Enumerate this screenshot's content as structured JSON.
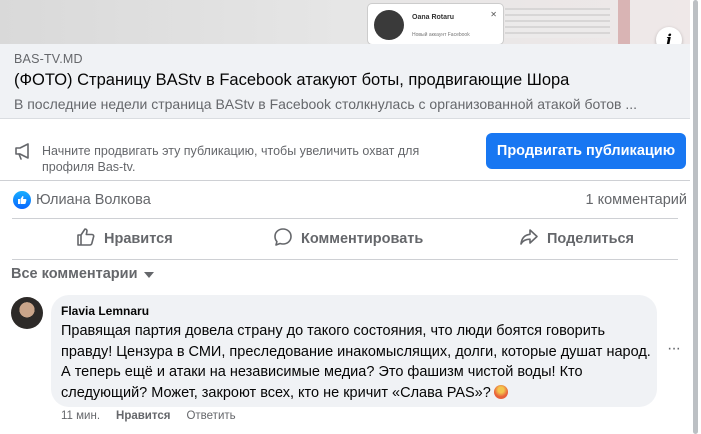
{
  "preview": {
    "card_name": "Oana Rotaru",
    "card_sub": "Новый аккаунт Facebook"
  },
  "link": {
    "domain": "BAS-TV.MD",
    "title": "(ФОТО) Страницу BAStv в Facebook атакуют боты, продвигающие Шора",
    "description": "В последние недели страница BAStv в Facebook столкнулась с организованной атакой ботов ..."
  },
  "promote": {
    "text_before": "Начните продвигать эту публикацию, чтобы увеличить охват для профиля ",
    "profile": "Bas-tv",
    "text_after": ".",
    "button_label": "Продвигать публикацию"
  },
  "reactions": {
    "reactor_name": "Юлиана Волкова",
    "comment_count": "1 комментарий"
  },
  "actions": {
    "like": "Нравится",
    "comment": "Комментировать",
    "share": "Поделиться"
  },
  "comments_filter": "Все комментарии",
  "comment": {
    "author": "Flavia Lemnaru",
    "text": "Правящая партия довела страну до такого состояния, что люди боятся говорить правду! Цензура в СМИ, преследование инакомыслящих, долги, которые душат народ. А теперь ещё и атаки на независимые медиа? Это фашизм чистой воды! Кто следующий? Может, закроют всех, кто не кричит «Слава PAS»?",
    "time": "11 мин.",
    "like": "Нравится",
    "reply": "Ответить"
  },
  "colors": {
    "accent": "#1877f2",
    "secondary_text": "#65676b",
    "bubble": "#f0f2f5"
  },
  "icons": [
    "megaphone-icon",
    "like-badge-icon",
    "thumbs-up-icon",
    "comment-icon",
    "share-icon",
    "info-icon",
    "angry-emoji-icon",
    "more-icon"
  ]
}
